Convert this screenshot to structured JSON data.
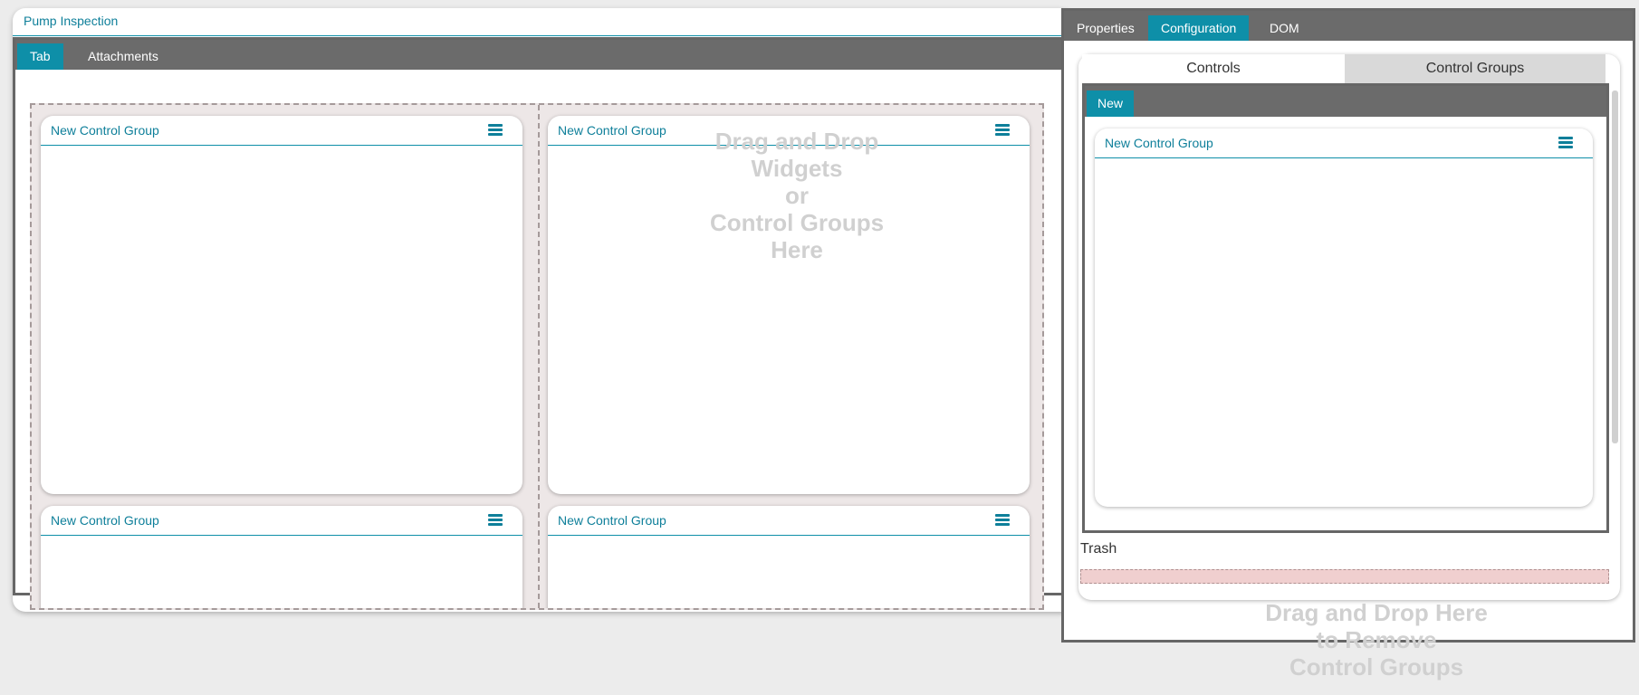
{
  "form": {
    "title": "Pump Inspection",
    "tabs": [
      "Tab",
      "Attachments"
    ],
    "control_groups": [
      {
        "title": "New Control Group"
      },
      {
        "title": "New Control Group"
      },
      {
        "title": "New Control Group"
      },
      {
        "title": "New Control Group"
      }
    ],
    "drop_hint": [
      "Drag and Drop",
      "Widgets",
      "or",
      "Control Groups",
      "Here"
    ]
  },
  "panel": {
    "tabs": [
      "Properties",
      "Configuration",
      "DOM"
    ],
    "subtabs": [
      "Controls",
      "Control Groups"
    ],
    "new_tab": "New",
    "template_group": {
      "title": "New Control Group"
    },
    "trash_label": "Trash",
    "trash_hint": [
      "Drag and Drop Here",
      "to Remove",
      "Control Groups"
    ]
  },
  "colors": {
    "accent": "#0e8fa8",
    "tab_bar": "#6b6b6b",
    "trash": "#f0cfcf"
  }
}
